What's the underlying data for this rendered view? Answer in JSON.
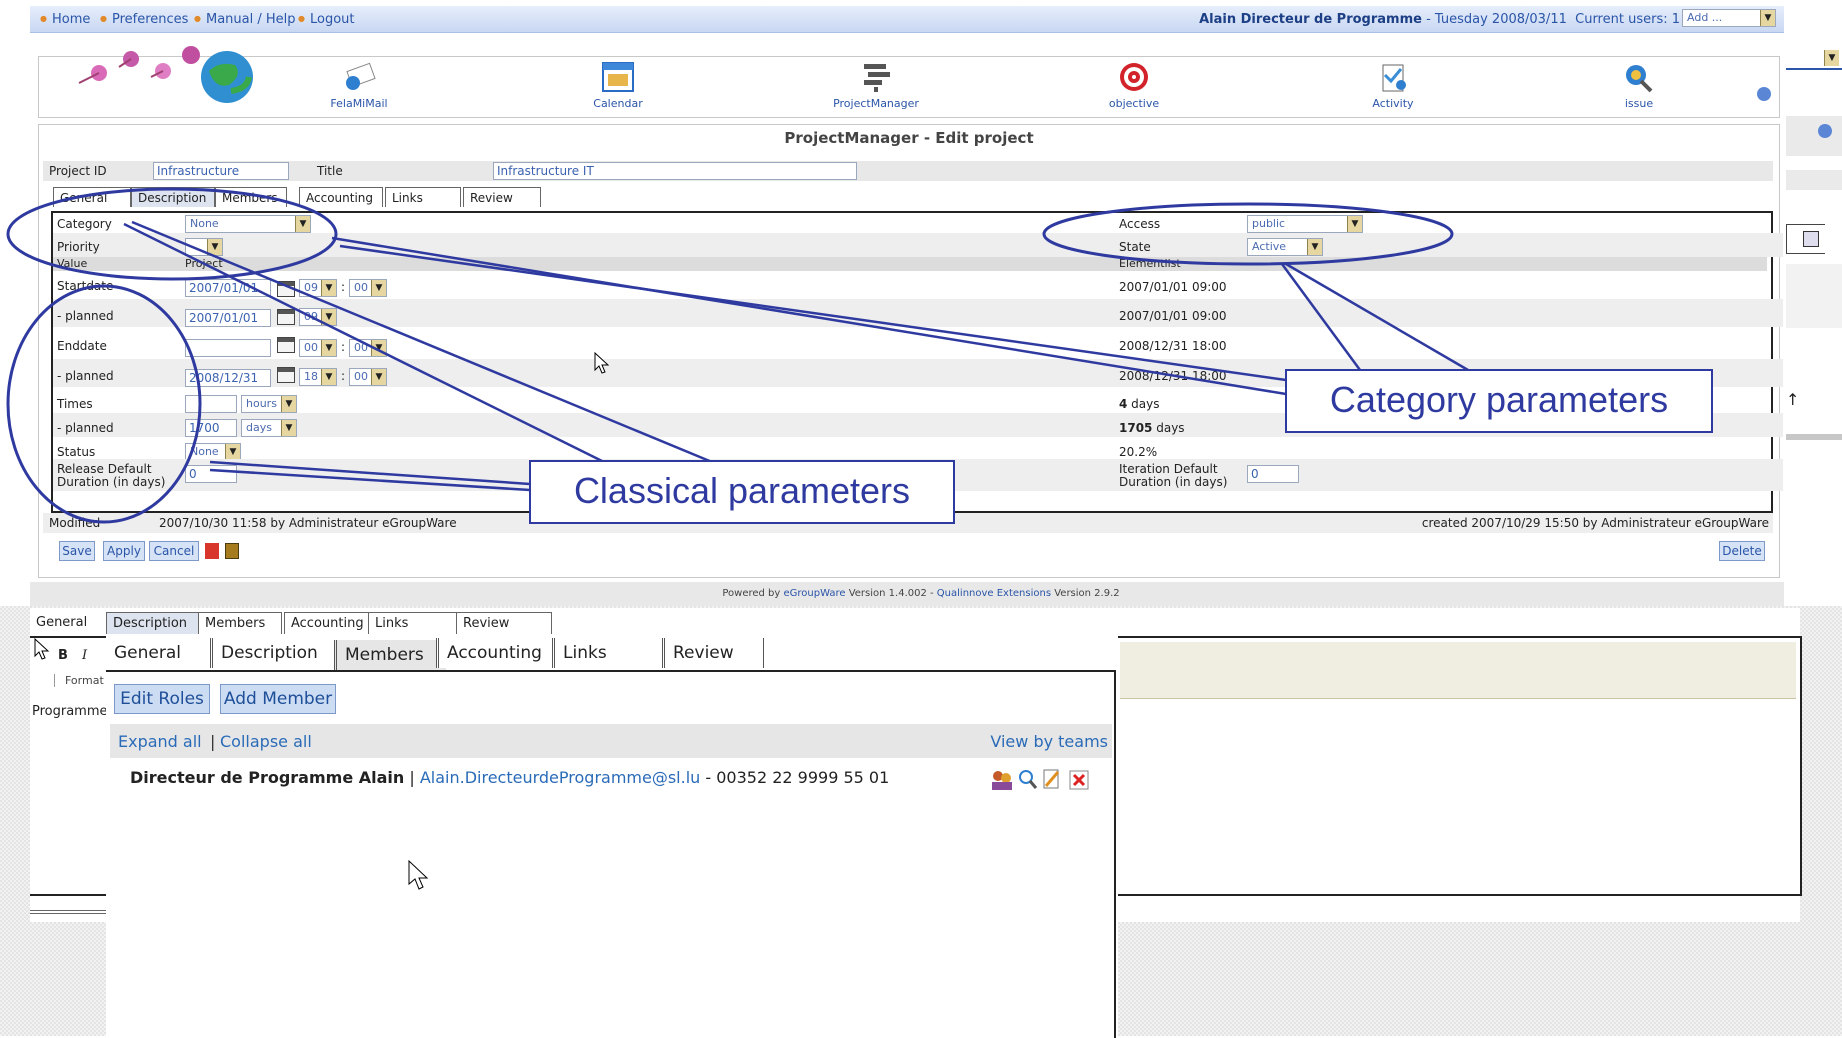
{
  "topbar": {
    "links": [
      "Home",
      "Preferences",
      "Manual / Help",
      "Logout"
    ],
    "user_name": "Alain Directeur de Programme",
    "date_text": " - Tuesday 2008/03/11",
    "current_users": "Current users: 1",
    "add_placeholder": "Add ..."
  },
  "apps": [
    "FelaMiMail",
    "Calendar",
    "ProjectManager",
    "objective",
    "Activity",
    "issue"
  ],
  "page_title": "ProjectManager - Edit project",
  "project": {
    "id_label": "Project ID",
    "id_value": "Infrastructure",
    "title_label": "Title",
    "title_value": "Infrastructure IT"
  },
  "tabs": [
    "General",
    "Description",
    "Members",
    "Accounting",
    "Links",
    "Review"
  ],
  "general": {
    "category_label": "Category",
    "category_value": "None",
    "priority_label": "Priority",
    "access_label": "Access",
    "access_value": "public",
    "state_label": "State",
    "state_value": "Active",
    "value_col": "Value",
    "project_col": "Project",
    "elementlist_col": "Elementlist",
    "startdate_label": "Startdate",
    "startdate_value": "2007/01/01",
    "start_hour": "09",
    "start_min": "00",
    "startdate_elem": "2007/01/01 09:00",
    "planned_label": "- planned",
    "planned_start_value": "2007/01/01",
    "planned_start_hour": "09",
    "planned_start_elem": "2007/01/01 09:00",
    "enddate_label": "Enddate",
    "end_hour": "00",
    "end_min": "00",
    "enddate_elem": "2008/12/31 18:00",
    "planned_end_value": "2008/12/31",
    "planned_end_hour": "18",
    "planned_end_min": "00",
    "planned_end_elem": "2008/12/31 18:00",
    "times_label": "Times",
    "times_unit": "hours",
    "times_elem_num": "4",
    "times_elem_unit": " days",
    "planned_times_value": "1700",
    "planned_times_unit": "days",
    "planned_times_elem_num": "1705",
    "planned_times_elem_unit": " days",
    "status_label": "Status",
    "status_value": "None",
    "status_elem": "20.2%",
    "release_label_1": "Release Default",
    "release_label_2": "Duration (in days)",
    "release_value": "0",
    "iteration_label_1": "Iteration Default",
    "iteration_label_2": "Duration (in days)",
    "iteration_value": "0",
    "modified_label": "Modified",
    "modified_value": "2007/10/30 11:58 by Administrateur eGroupWare",
    "created_value": "created 2007/10/29 15:50 by Administrateur eGroupWare"
  },
  "buttons": {
    "save": "Save",
    "apply": "Apply",
    "cancel": "Cancel",
    "delete": "Delete"
  },
  "footer": {
    "powered_by": "Powered by ",
    "egroupware": "eGroupWare",
    "version": " Version 1.4.002 - ",
    "qualinnove": "Qualinnove Extensions",
    "ext_version": " Version 2.9.2"
  },
  "annotations": {
    "classical": "Classical parameters",
    "category": "Category parameters"
  },
  "members": {
    "editor_format": "Format",
    "editor_text": "Programme",
    "edit_roles": "Edit Roles",
    "add_member": "Add Member",
    "expand_all": "Expand all",
    "separator": " | ",
    "collapse_all": "Collapse all",
    "view_by_teams": "View by teams",
    "member_name": "Directeur de Programme Alain",
    "member_email": "Alain.DirecteurdeProgramme@sl.lu",
    "member_phone": " - 00352 22 9999 55 01"
  },
  "colors": {
    "link": "#2a55a8",
    "annotation": "#2f3aa0",
    "topbar": "#c8d7f2"
  }
}
